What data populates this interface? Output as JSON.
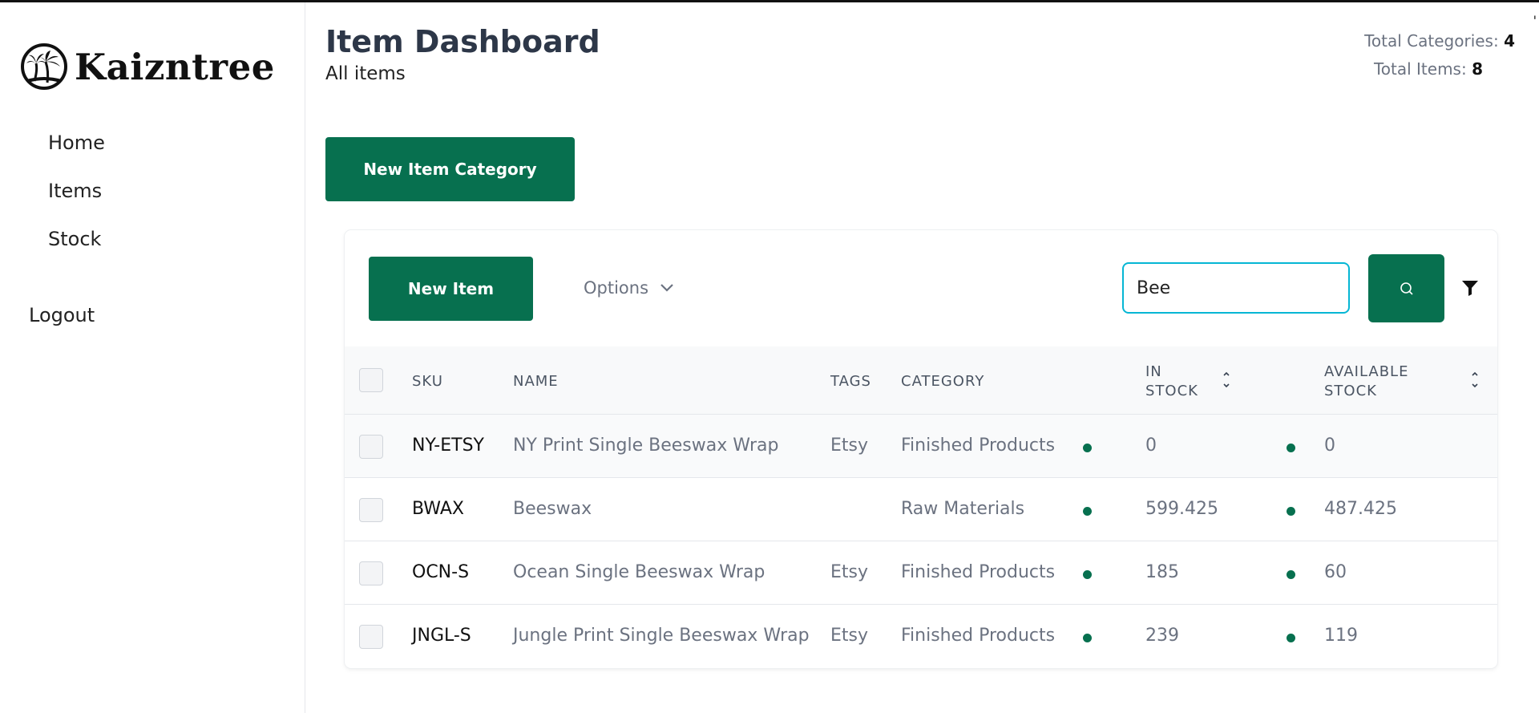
{
  "brand": {
    "name": "Kaizntree",
    "logo_icon": "palm-tree-logo-icon"
  },
  "sidebar": {
    "items": [
      {
        "label": "Home"
      },
      {
        "label": "Items"
      },
      {
        "label": "Stock"
      }
    ],
    "logout_label": "Logout"
  },
  "header": {
    "title": "Item Dashboard",
    "subtitle": "All items",
    "corner_mark": "'"
  },
  "stats": {
    "categories_label": "Total Categories:",
    "categories_value": "4",
    "items_label": "Total Items:",
    "items_value": "8"
  },
  "actions": {
    "new_category_label": "New Item Category",
    "new_item_label": "New Item",
    "options_label": "Options"
  },
  "search": {
    "value": "Bee",
    "icon": "search-icon"
  },
  "filter": {
    "icon": "filter-icon"
  },
  "colors": {
    "primary": "#07704f",
    "search_border": "#06b6d4",
    "status_dot": "#07704f"
  },
  "table": {
    "columns": {
      "sku": "SKU",
      "name": "NAME",
      "tags": "TAGS",
      "category": "CATEGORY",
      "in_stock_1": "IN",
      "in_stock_2": "STOCK",
      "available_1": "AVAILABLE",
      "available_2": "STOCK"
    },
    "rows": [
      {
        "sku": "NY-ETSY",
        "name": "NY Print Single Beeswax Wrap",
        "tags": "Etsy",
        "category": "Finished Products",
        "in_stock": "0",
        "available": "0"
      },
      {
        "sku": "BWAX",
        "name": "Beeswax",
        "tags": "",
        "category": "Raw Materials",
        "in_stock": "599.425",
        "available": "487.425"
      },
      {
        "sku": "OCN-S",
        "name": "Ocean Single Beeswax Wrap",
        "tags": "Etsy",
        "category": "Finished Products",
        "in_stock": "185",
        "available": "60"
      },
      {
        "sku": "JNGL-S",
        "name": "Jungle Print Single Beeswax Wrap",
        "tags": "Etsy",
        "category": "Finished Products",
        "in_stock": "239",
        "available": "119"
      }
    ]
  }
}
